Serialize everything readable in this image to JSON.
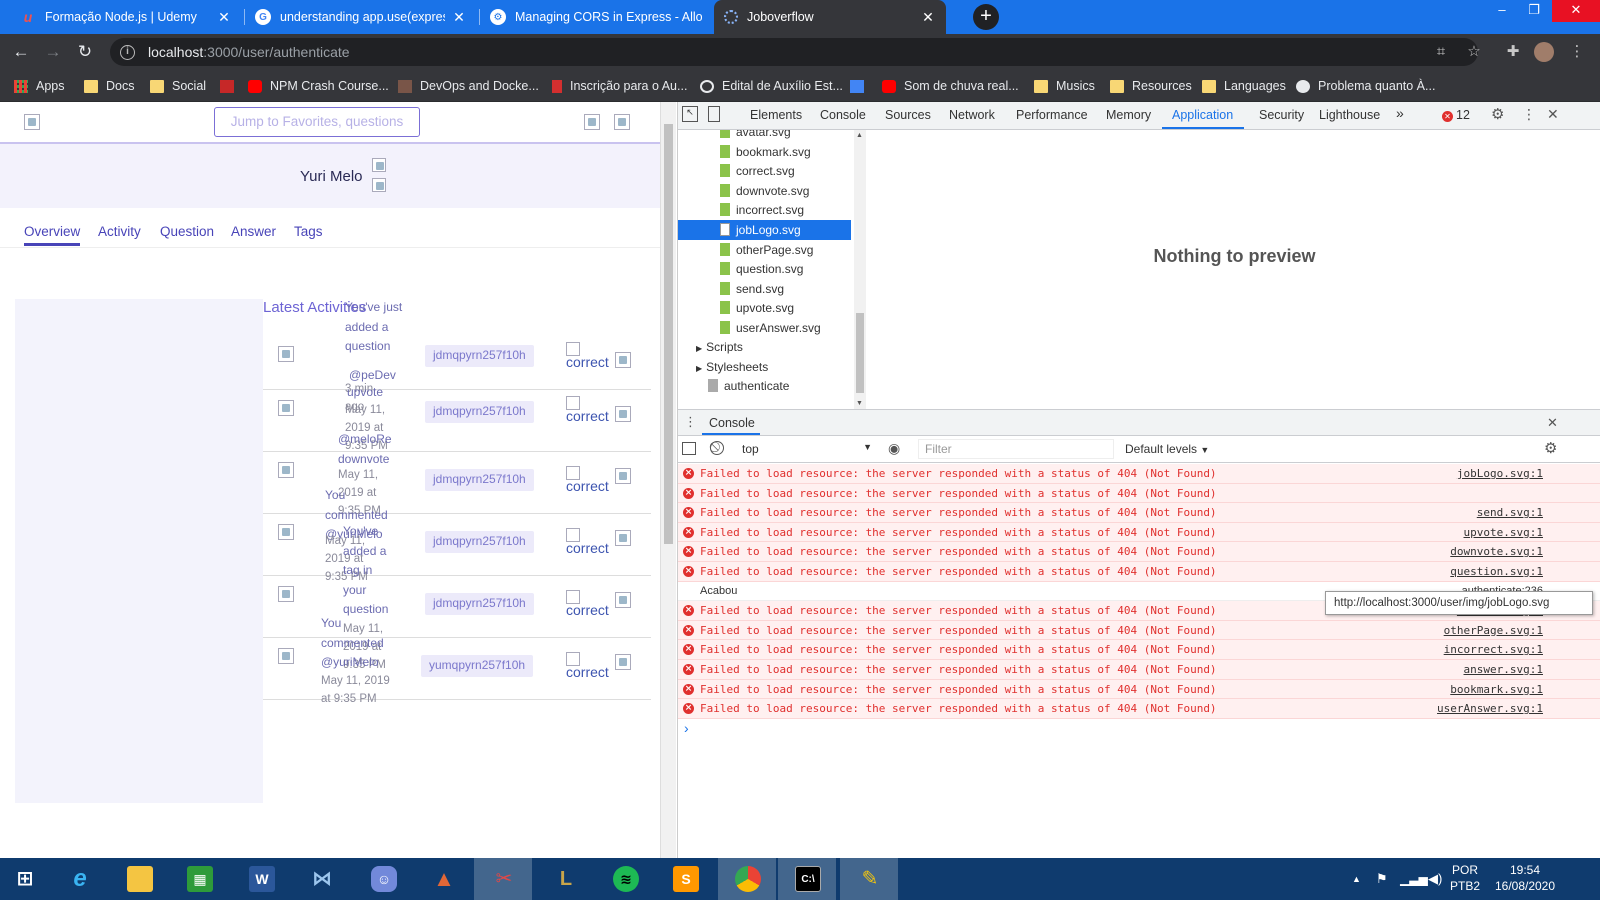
{
  "browser": {
    "tabs": [
      {
        "title": "Formação Node.js | Udemy",
        "favicon": "udemy-icon"
      },
      {
        "title": "understanding app.use(express.st",
        "favicon": "google-icon"
      },
      {
        "title": "Managing CORS in Express - Allo",
        "favicon": "cors-icon"
      },
      {
        "title": "Joboverflow",
        "favicon": "loading-icon"
      }
    ],
    "url_host": "localhost",
    "url_path": ":3000/user/authenticate",
    "bookmarks": [
      "Apps",
      "Docs",
      "Social",
      "NPM Crash Course...",
      "DevOps and Docke...",
      "Inscrição para o Au...",
      "Edital de Auxílio Est...",
      "Som de chuva real...",
      "Musics",
      "Resources",
      "Languages",
      "Problema quanto À..."
    ]
  },
  "page": {
    "search_placeholder": "Jump to Favorites, questions",
    "username": "Yuri Melo",
    "tabs": [
      "Overview",
      "Activity",
      "Question",
      "Answer",
      "Tags"
    ],
    "latest_title": "Latest Activities",
    "activities": [
      {
        "text": "You've just added a question",
        "extra": "@peDev",
        "date": "3 min ago",
        "user": "jdmqpyrn257f10h",
        "img_alt": "correct"
      },
      {
        "text": "upvote",
        "extra": "",
        "date": "May 11, 2019 at 9:35 PM",
        "user": "jdmqpyrn257f10h",
        "img_alt": "correct"
      },
      {
        "text": "@meloRe downvote",
        "extra": "",
        "date": "May 11, 2019 at 9:35 PM",
        "user": "jdmqpyrn257f10h",
        "img_alt": "correct"
      },
      {
        "text": "You commented @yuriMelo",
        "extra": "",
        "date": "May 11, 2019 at 9:35 PM",
        "user": "jdmqpyrn257f10h",
        "img_alt": "correct"
      },
      {
        "text": "You've added a tag in your question",
        "extra": "",
        "date": "May 11, 2019 at 9:35 PM",
        "user": "jdmqpyrn257f10h",
        "img_alt": "correct"
      },
      {
        "text": "You commented @yuriMelo",
        "extra": "",
        "date": "May 11, 2019 at 9:35 PM",
        "user": "yumqpyrn257f10h",
        "img_alt": "correct"
      }
    ]
  },
  "devtools": {
    "tabs": [
      "Elements",
      "Console",
      "Sources",
      "Network",
      "Performance",
      "Memory",
      "Application",
      "Security",
      "Lighthouse"
    ],
    "selected_tab": "Application",
    "more": "»",
    "error_count": "12",
    "files": [
      "avatar.svg",
      "bookmark.svg",
      "correct.svg",
      "downvote.svg",
      "incorrect.svg",
      "jobLogo.svg",
      "otherPage.svg",
      "question.svg",
      "send.svg",
      "upvote.svg",
      "userAnswer.svg"
    ],
    "selected_file": "jobLogo.svg",
    "folders": [
      "Scripts",
      "Stylesheets"
    ],
    "page_item": "authenticate",
    "preview_text": "Nothing to preview",
    "drawer_tab": "Console",
    "context": "top",
    "filter_placeholder": "Filter",
    "levels": "Default levels",
    "tooltip": "http://localhost:3000/user/img/jobLogo.svg",
    "console": [
      {
        "type": "error",
        "msg": "Failed to load resource: the server responded with a status of 404 (Not Found)",
        "src": "jobLogo.svg:1"
      },
      {
        "type": "error",
        "msg": "Failed to load resource: the server responded with a status of 404 (Not Found)",
        "src": ""
      },
      {
        "type": "error",
        "msg": "Failed to load resource: the server responded with a status of 404 (Not Found)",
        "src": "send.svg:1"
      },
      {
        "type": "error",
        "msg": "Failed to load resource: the server responded with a status of 404 (Not Found)",
        "src": "upvote.svg:1"
      },
      {
        "type": "error",
        "msg": "Failed to load resource: the server responded with a status of 404 (Not Found)",
        "src": "downvote.svg:1"
      },
      {
        "type": "error",
        "msg": "Failed to load resource: the server responded with a status of 404 (Not Found)",
        "src": "question.svg:1"
      },
      {
        "type": "log",
        "msg": "Acabou",
        "src": "authenticate:236"
      },
      {
        "type": "error",
        "msg": "Failed to load resource: the server responded with a status of 404 (Not Found)",
        "src": "correct.svg:1"
      },
      {
        "type": "error",
        "msg": "Failed to load resource: the server responded with a status of 404 (Not Found)",
        "src": "otherPage.svg:1"
      },
      {
        "type": "error",
        "msg": "Failed to load resource: the server responded with a status of 404 (Not Found)",
        "src": "incorrect.svg:1"
      },
      {
        "type": "error",
        "msg": "Failed to load resource: the server responded with a status of 404 (Not Found)",
        "src": "answer.svg:1"
      },
      {
        "type": "error",
        "msg": "Failed to load resource: the server responded with a status of 404 (Not Found)",
        "src": "bookmark.svg:1"
      },
      {
        "type": "error",
        "msg": "Failed to load resource: the server responded with a status of 404 (Not Found)",
        "src": "userAnswer.svg:1"
      }
    ],
    "prompt": "›"
  },
  "taskbar": {
    "apps": [
      "windows-start-icon",
      "internet-explorer-icon",
      "file-explorer-icon",
      "store-icon",
      "word-icon",
      "vs-code-icon",
      "discord-icon",
      "matlab-icon",
      "snipping-icon",
      "league-icon",
      "spotify-icon",
      "sublime-icon",
      "chrome-icon",
      "terminal-icon",
      "paint-icon"
    ],
    "lang": "POR",
    "layout": "PTB2",
    "time": "19:54",
    "date": "16/08/2020"
  },
  "colors": {
    "tab_strip": "#1a73e8",
    "chrome_dark": "#35363a",
    "accent_purple": "#4844b8",
    "error_red": "#e0302e",
    "taskbar": "#0f3b6e"
  }
}
